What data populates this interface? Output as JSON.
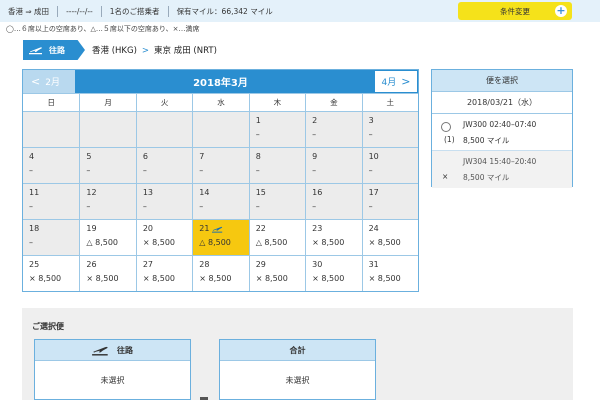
{
  "topbar": {
    "route": "香港 ⇒ 成田",
    "date": "----/--/--",
    "passengers": "1名のご搭乗者",
    "miles": "保有マイル：66,342 マイル",
    "change_button": "条件変更",
    "plus_icon": "+"
  },
  "legend": "◯…６席以上の空席あり、△…５席以下の空席あり、×…満席",
  "route": {
    "tag": "往路",
    "origin": "香港 (HKG)",
    "separator": ">",
    "destination": "東京 成田 (NRT)"
  },
  "calendar": {
    "title": "2018年3月",
    "prev_label": "2月",
    "next_label": "4月",
    "prev_chevron": "<",
    "next_chevron": ">",
    "weekdays": [
      "日",
      "月",
      "火",
      "水",
      "木",
      "金",
      "土"
    ],
    "weeks": [
      [
        {
          "day": "",
          "avail": "",
          "state": "gray"
        },
        {
          "day": "",
          "avail": "",
          "state": "gray"
        },
        {
          "day": "",
          "avail": "",
          "state": "gray"
        },
        {
          "day": "",
          "avail": "",
          "state": "gray"
        },
        {
          "day": "1",
          "avail": "–",
          "state": "gray"
        },
        {
          "day": "2",
          "avail": "–",
          "state": "gray"
        },
        {
          "day": "3",
          "avail": "–",
          "state": "gray"
        }
      ],
      [
        {
          "day": "4",
          "avail": "–",
          "state": "gray"
        },
        {
          "day": "5",
          "avail": "–",
          "state": "gray"
        },
        {
          "day": "6",
          "avail": "–",
          "state": "gray"
        },
        {
          "day": "7",
          "avail": "–",
          "state": "gray"
        },
        {
          "day": "8",
          "avail": "–",
          "state": "gray"
        },
        {
          "day": "9",
          "avail": "–",
          "state": "gray"
        },
        {
          "day": "10",
          "avail": "–",
          "state": "gray"
        }
      ],
      [
        {
          "day": "11",
          "avail": "–",
          "state": "gray"
        },
        {
          "day": "12",
          "avail": "–",
          "state": "gray"
        },
        {
          "day": "13",
          "avail": "–",
          "state": "gray"
        },
        {
          "day": "14",
          "avail": "–",
          "state": "gray"
        },
        {
          "day": "15",
          "avail": "–",
          "state": "gray"
        },
        {
          "day": "16",
          "avail": "–",
          "state": "gray"
        },
        {
          "day": "17",
          "avail": "–",
          "state": "gray"
        }
      ],
      [
        {
          "day": "18",
          "avail": "–",
          "state": "gray"
        },
        {
          "day": "19",
          "avail": "△ 8,500",
          "state": "white"
        },
        {
          "day": "20",
          "avail": "× 8,500",
          "state": "white"
        },
        {
          "day": "21",
          "avail": "△ 8,500",
          "state": "selected"
        },
        {
          "day": "22",
          "avail": "△ 8,500",
          "state": "white"
        },
        {
          "day": "23",
          "avail": "× 8,500",
          "state": "white"
        },
        {
          "day": "24",
          "avail": "× 8,500",
          "state": "white"
        }
      ],
      [
        {
          "day": "25",
          "avail": "× 8,500",
          "state": "white"
        },
        {
          "day": "26",
          "avail": "× 8,500",
          "state": "white"
        },
        {
          "day": "27",
          "avail": "× 8,500",
          "state": "white"
        },
        {
          "day": "28",
          "avail": "× 8,500",
          "state": "white"
        },
        {
          "day": "29",
          "avail": "× 8,500",
          "state": "white"
        },
        {
          "day": "30",
          "avail": "× 8,500",
          "state": "white"
        },
        {
          "day": "31",
          "avail": "× 8,500",
          "state": "white"
        }
      ]
    ]
  },
  "flight_panel": {
    "title": "便を選択",
    "date": "2018/03/21（水）",
    "flights": [
      {
        "mark": "(1)",
        "code": "JW300",
        "time": "02:40–07:40",
        "miles": "8,500 マイル",
        "selectable": true
      },
      {
        "mark": "×",
        "code": "JW304",
        "time": "15:40–20:40",
        "miles": "8,500 マイル",
        "selectable": false
      }
    ]
  },
  "selected": {
    "title": "ご選択便",
    "outbound_label": "往路",
    "outbound_value": "未選択",
    "total_label": "合計",
    "total_value": "未選択"
  },
  "colors": {
    "accent": "#2a8ed0",
    "selected_day": "#f6c810",
    "button_yellow": "#f5e21a",
    "header_light": "#cde5f5"
  },
  "icons": [
    "plane-icon",
    "plus-icon",
    "chevron-left-icon",
    "chevron-right-icon"
  ]
}
